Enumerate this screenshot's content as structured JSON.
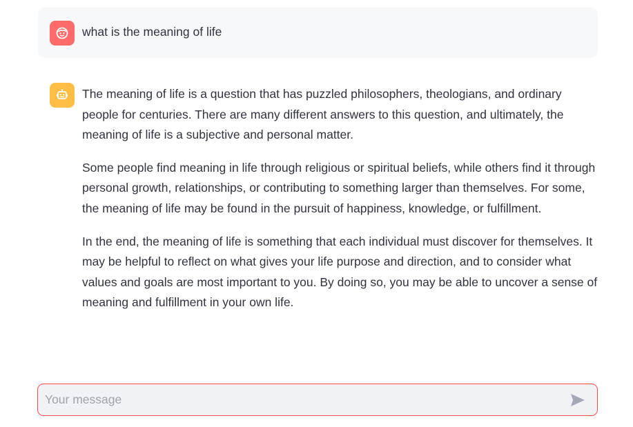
{
  "conversation": {
    "messages": [
      {
        "role": "user",
        "avatar_icon": "face-icon",
        "avatar_color": "#ff6b6b",
        "text": "what is the meaning of life"
      },
      {
        "role": "assistant",
        "avatar_icon": "robot-icon",
        "avatar_color": "#ffbd45",
        "paragraphs": [
          "The meaning of life is a question that has puzzled philosophers, theologians, and ordinary people for centuries. There are many different answers to this question, and ultimately, the meaning of life is a subjective and personal matter.",
          "Some people find meaning in life through religious or spiritual beliefs, while others find it through personal growth, relationships, or contributing to something larger than themselves. For some, the meaning of life may be found in the pursuit of happiness, knowledge, or fulfillment.",
          "In the end, the meaning of life is something that each individual must discover for themselves. It may be helpful to reflect on what gives your life purpose and direction, and to consider what values and goals are most important to you. By doing so, you may be able to uncover a sense of meaning and fulfillment in your own life."
        ]
      }
    ]
  },
  "chat_input": {
    "placeholder": "Your message",
    "value": "",
    "send_icon": "send-icon",
    "accent_color": "#ff4b4b"
  }
}
